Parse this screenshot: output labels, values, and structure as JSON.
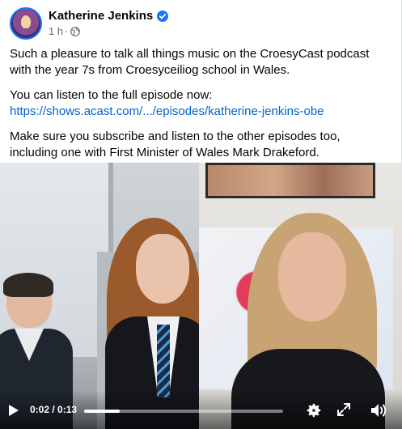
{
  "post": {
    "author": "Katherine Jenkins",
    "verified": true,
    "timestamp": "1 h",
    "separator": "·",
    "privacy_icon": "globe-icon",
    "paragraphs": {
      "p1": "Such a pleasure to talk all things music on the CroesyCast podcast with the year 7s from Croesyceiliog school in Wales.",
      "p2_text": "You can listen to the full episode now:",
      "p2_link": "https://shows.acast.com/.../episodes/katherine-jenkins-obe",
      "p3": "Make sure you subscribe and listen to the other episodes too, including one with First Minister of Wales Mark Drakeford."
    }
  },
  "video": {
    "current_time": "0:02",
    "duration": "0:13",
    "time_display": "0:02 / 0:13",
    "progress_fraction": 0.18,
    "controls": {
      "play_icon": "play-icon",
      "settings_icon": "gear-icon",
      "fullscreen_icon": "expand-icon",
      "volume_icon": "speaker-icon"
    }
  },
  "colors": {
    "accent_blue": "#1877f2",
    "link_blue": "#0064d1",
    "meta_gray": "#65676b",
    "text": "#050505"
  }
}
